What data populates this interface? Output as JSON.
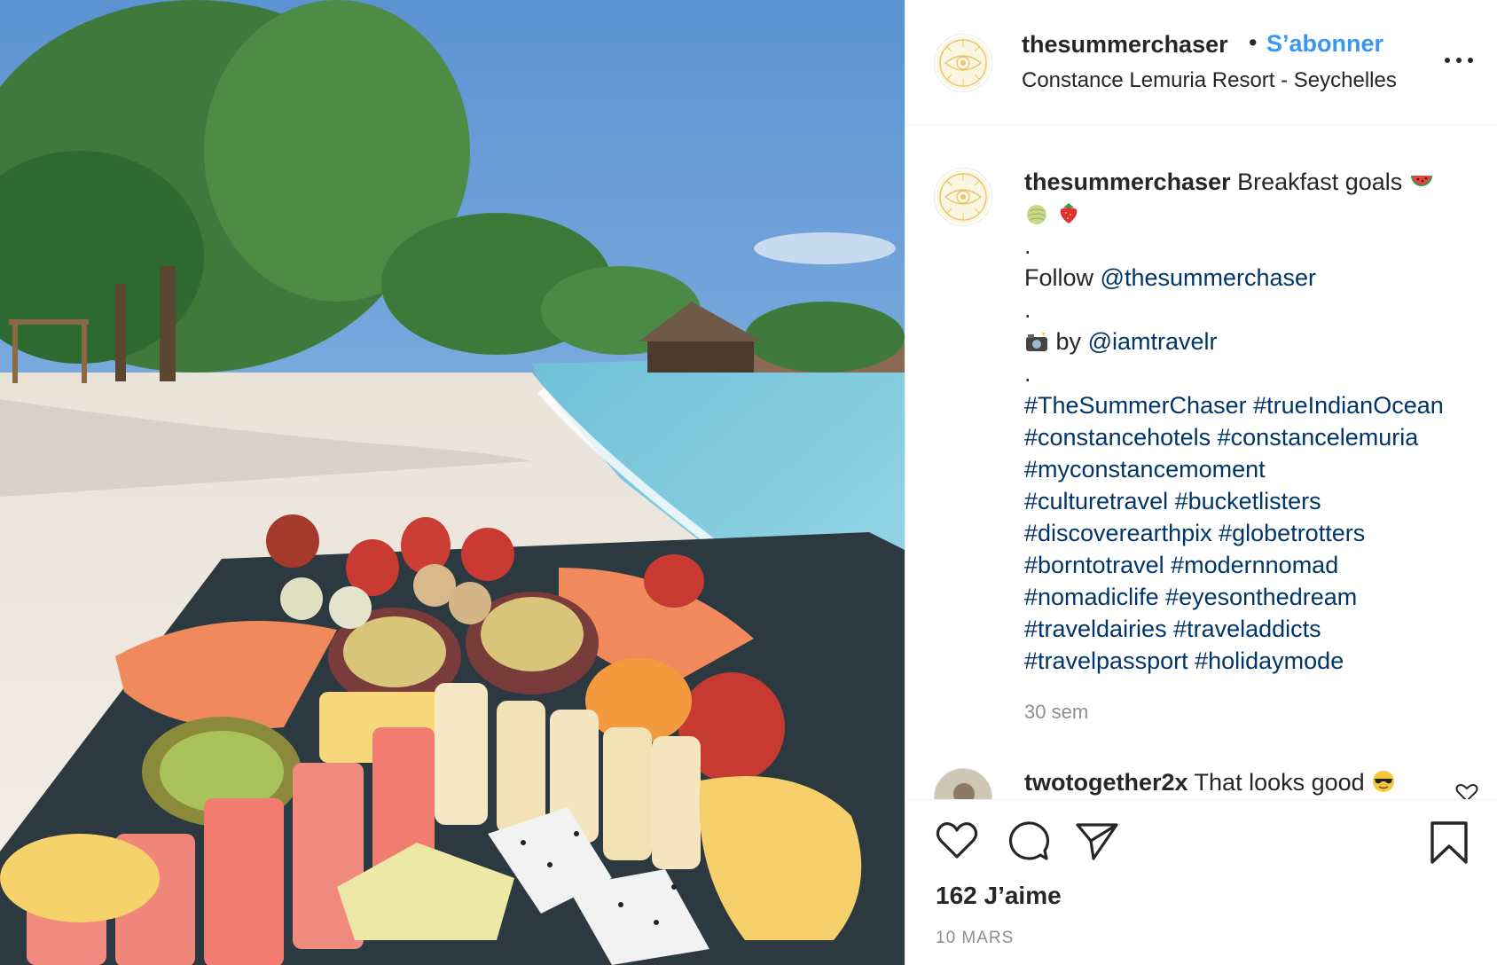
{
  "header": {
    "username": "thesummerchaser",
    "separator": "•",
    "follow_label": "S’abonner",
    "location": "Constance Lemuria Resort - Seychelles"
  },
  "caption": {
    "username": "thesummerchaser",
    "text": "Breakfast goals",
    "emojis": [
      "watermelon-emoji",
      "melon-emoji",
      "strawberry-emoji"
    ],
    "dot": ".",
    "follow_prefix": "Follow",
    "follow_mention": "@thesummerchaser",
    "photo_by_icon": "camera-flash-emoji",
    "by_label": "by",
    "by_mention": "@iamtravelr",
    "hashtag_lines": [
      "#TheSummerChaser #trueIndianOcean",
      "#constancehotels #constancelemuria",
      "#myconstancemoment",
      "#culturetravel #bucketlisters",
      "#discoverearthpix #globetrotters",
      "#borntotravel #modernnomad",
      "#nomadiclife #eyesonthedream",
      "#traveldairies #traveladdicts",
      "#travelpassport #holidaymode"
    ],
    "timestamp": "30 sem"
  },
  "comment": {
    "username": "twotogether2x",
    "text": "That looks good",
    "emoji": "sunglasses-emoji"
  },
  "actions": {
    "likes": "162 J’aime",
    "date": "10 MARS",
    "icons": [
      "heart-icon",
      "comment-icon",
      "share-icon",
      "bookmark-icon"
    ]
  },
  "colors": {
    "link_blue": "#3897f0",
    "tag_blue": "#003569",
    "muted": "#8e8e8e",
    "text": "#262626"
  }
}
